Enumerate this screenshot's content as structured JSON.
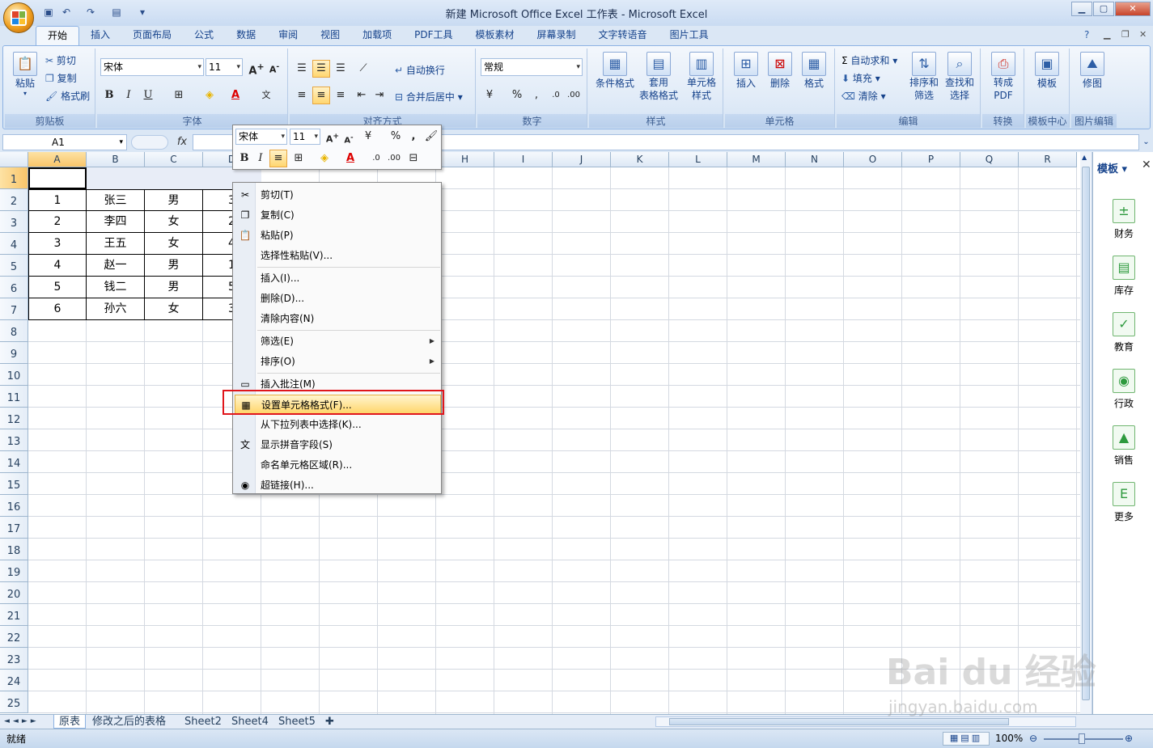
{
  "window": {
    "title": "新建 Microsoft Office Excel 工作表 - Microsoft Excel"
  },
  "ribbon_tabs": [
    "开始",
    "插入",
    "页面布局",
    "公式",
    "数据",
    "审阅",
    "视图",
    "加载项",
    "PDF工具",
    "模板素材",
    "屏幕录制",
    "文字转语音",
    "图片工具"
  ],
  "clipboard": {
    "paste": "粘贴",
    "cut": "剪切",
    "copy": "复制",
    "format_painter": "格式刷",
    "label": "剪贴板"
  },
  "font": {
    "name": "宋体",
    "size": "11",
    "label": "字体"
  },
  "alignment": {
    "wrap": "自动换行",
    "merge": "合并后居中",
    "label": "对齐方式"
  },
  "number": {
    "format": "常规",
    "label": "数字"
  },
  "styles": {
    "cond": "条件格式",
    "table_fmt": "套用\n表格格式",
    "cell_style": "单元格\n样式",
    "label": "样式"
  },
  "cells": {
    "insert": "插入",
    "delete": "删除",
    "format": "格式",
    "label": "单元格"
  },
  "editing": {
    "autosum": "自动求和",
    "fill": "填充",
    "clear": "清除",
    "sort": "排序和\n筛选",
    "find": "查找和\n选择",
    "label": "编辑"
  },
  "convert": {
    "pdf": "转成\nPDF",
    "label": "转换"
  },
  "template_group": {
    "btn": "模板",
    "label": "模板中心"
  },
  "image_group": {
    "btn": "修图",
    "label": "图片编辑"
  },
  "namebox": "A1",
  "fx": "fx",
  "columns": [
    "A",
    "B",
    "C",
    "D",
    "E",
    "F",
    "G",
    "H",
    "I",
    "J",
    "K",
    "L",
    "M",
    "N",
    "O",
    "P",
    "Q",
    "R"
  ],
  "rows": [
    "1",
    "2",
    "3",
    "4",
    "5",
    "6",
    "7",
    "8",
    "9",
    "10",
    "11",
    "12",
    "13",
    "14",
    "15",
    "16",
    "17",
    "18",
    "19",
    "20",
    "21",
    "22",
    "23",
    "24",
    "25"
  ],
  "table": [
    [
      "1",
      "张三",
      "男",
      "3"
    ],
    [
      "2",
      "李四",
      "女",
      "2"
    ],
    [
      "3",
      "王五",
      "女",
      "4"
    ],
    [
      "4",
      "赵一",
      "男",
      "1"
    ],
    [
      "5",
      "钱二",
      "男",
      "5"
    ],
    [
      "6",
      "孙六",
      "女",
      "3"
    ]
  ],
  "minibar": {
    "font": "宋体",
    "size": "11"
  },
  "context_menu": [
    {
      "label": "剪切(T)",
      "icon": "scissors-icon",
      "glyph": "✂"
    },
    {
      "label": "复制(C)",
      "icon": "copy-icon",
      "glyph": "❐"
    },
    {
      "label": "粘贴(P)",
      "icon": "paste-icon",
      "glyph": "📋"
    },
    {
      "label": "选择性粘贴(V)...",
      "icon": "",
      "glyph": ""
    },
    {
      "sep": true
    },
    {
      "label": "插入(I)...",
      "icon": "",
      "glyph": ""
    },
    {
      "label": "删除(D)...",
      "icon": "",
      "glyph": ""
    },
    {
      "label": "清除内容(N)",
      "icon": "",
      "glyph": ""
    },
    {
      "sep": true
    },
    {
      "label": "筛选(E)",
      "icon": "",
      "glyph": "",
      "sub": true
    },
    {
      "label": "排序(O)",
      "icon": "",
      "glyph": "",
      "sub": true
    },
    {
      "sep": true
    },
    {
      "label": "插入批注(M)",
      "icon": "comment-icon",
      "glyph": "▭"
    },
    {
      "label": "设置单元格格式(F)...",
      "icon": "format-cells-icon",
      "glyph": "▦",
      "hl": true
    },
    {
      "label": "从下拉列表中选择(K)...",
      "icon": "",
      "glyph": ""
    },
    {
      "label": "显示拼音字段(S)",
      "icon": "pinyin-icon",
      "glyph": "文"
    },
    {
      "label": "命名单元格区域(R)...",
      "icon": "",
      "glyph": ""
    },
    {
      "label": "超链接(H)...",
      "icon": "hyperlink-icon",
      "glyph": "◉"
    }
  ],
  "pane": {
    "title": "模板",
    "items": [
      "财务",
      "库存",
      "教育",
      "行政",
      "销售",
      "更多"
    ]
  },
  "sheets": [
    "原表",
    "修改之后的表格",
    "Sheet2",
    "Sheet4",
    "Sheet5"
  ],
  "status": {
    "ready": "就绪",
    "zoom": "100%"
  },
  "watermark": {
    "brand": "Bai du 经验",
    "url": "jingyan.baidu.com"
  }
}
